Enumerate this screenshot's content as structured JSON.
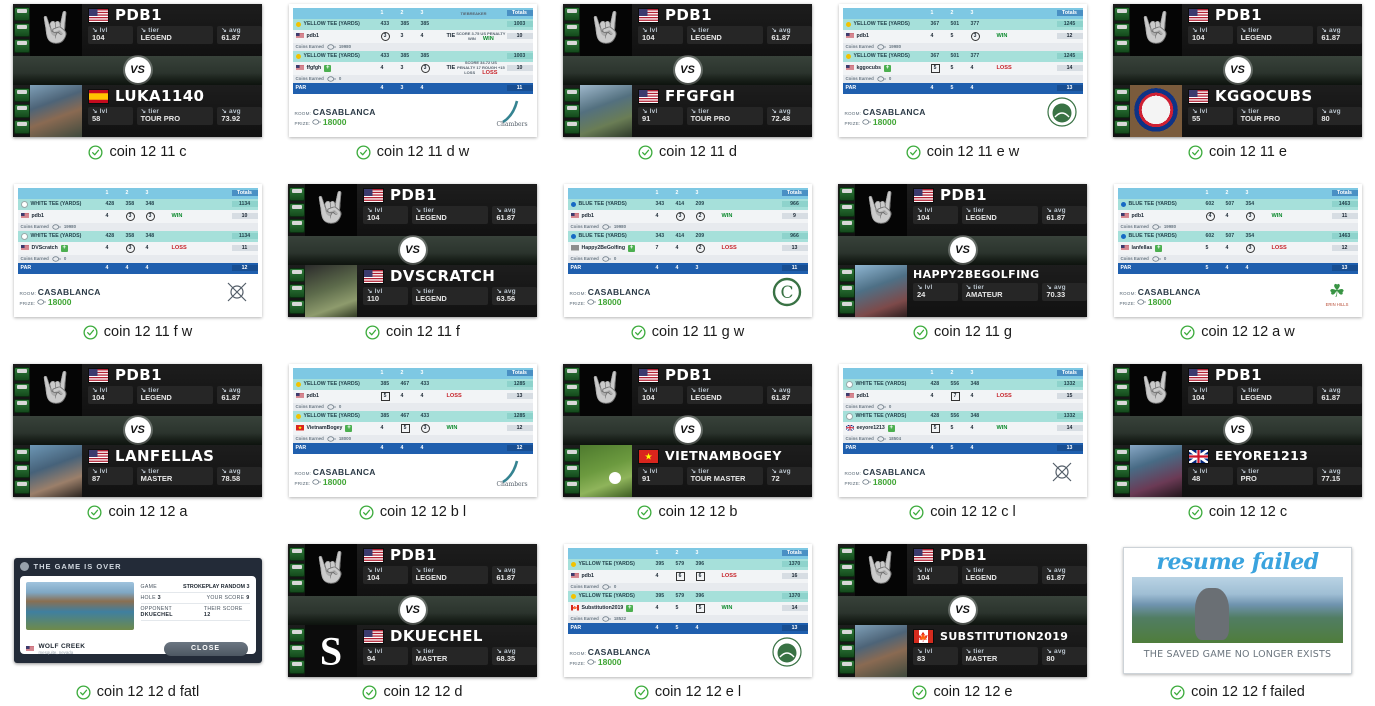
{
  "gallery": {
    "items": [
      {
        "caption": "coin 12 11 c",
        "type": "vs",
        "top": {
          "name": "PDB1",
          "flag": "us",
          "lvl_label": "lvl",
          "lvl": "104",
          "tier_label": "tier",
          "tier": "LEGEND",
          "avg_label": "avg",
          "avg": "61.87",
          "avatar": "skull"
        },
        "bottom": {
          "name": "LUKA1140",
          "flag": "es",
          "lvl_label": "lvl",
          "lvl": "58",
          "tier_label": "tier",
          "tier": "TOUR PRO",
          "avg_label": "avg",
          "avg": "73.92",
          "avatar": "face1"
        },
        "vs": "VS"
      },
      {
        "caption": "coin 12 11 d w",
        "type": "scorecard",
        "tee": "YELLOW TEE (YARDS)",
        "tee_color": "y",
        "yards": [
          "433",
          "385",
          "385"
        ],
        "hdr_holes": [
          "1",
          "2",
          "3"
        ],
        "hdr_tiebreak": "TIEBREAKER",
        "hdr_total": "Totals",
        "yards_total": "1003",
        "p1": {
          "name": "pdb1",
          "flag": "us",
          "scores": [
            "3",
            "3",
            "4"
          ],
          "marks": [
            "circle",
            "",
            ""
          ],
          "result": "TIE",
          "total": "10",
          "coins_label": "Coins Earned",
          "coins": "19980"
        },
        "p2": {
          "name": "ffgfgh",
          "flag": "us",
          "scores": [
            "4",
            "3",
            "3"
          ],
          "marks": [
            "",
            "",
            "circle"
          ],
          "result": "TIE",
          "total": "10",
          "coins_label": "Coins Earned",
          "coins": "0"
        },
        "tb1": "SCORE 3.75  US PENALTY  WIN",
        "tb2": "SCORE 34.72  US PENALTY 17 ROUGH +15  LOSS",
        "tb1_res": "WIN",
        "tb2_res": "LOSS",
        "par_label": "PAR",
        "par": [
          "4",
          "3",
          "4"
        ],
        "par_total": "11",
        "room_label": "ROOM:",
        "room": "CASABLANCA",
        "prize_label": "PRIZE:",
        "prize": "18000",
        "logo": "chambers-bay"
      },
      {
        "caption": "coin 12 11 d",
        "type": "vs",
        "top": {
          "name": "PDB1",
          "flag": "us",
          "lvl_label": "lvl",
          "lvl": "104",
          "tier_label": "tier",
          "tier": "LEGEND",
          "avg_label": "avg",
          "avg": "61.87",
          "avatar": "skull"
        },
        "bottom": {
          "name": "FFGFGH",
          "flag": "us",
          "lvl_label": "lvl",
          "lvl": "91",
          "tier_label": "tier",
          "tier": "TOUR PRO",
          "avg_label": "avg",
          "avg": "72.48",
          "avatar": "face2"
        },
        "vs": "VS"
      },
      {
        "caption": "coin 12 11 e w",
        "type": "scorecard",
        "tee": "YELLOW TEE (YARDS)",
        "tee_color": "y",
        "yards": [
          "367",
          "501",
          "377"
        ],
        "hdr_holes": [
          "1",
          "2",
          "3"
        ],
        "hdr_tiebreak": "",
        "hdr_total": "Totals",
        "yards_total": "1245",
        "p1": {
          "name": "pdb1",
          "flag": "us",
          "scores": [
            "4",
            "5",
            "3"
          ],
          "marks": [
            "",
            "",
            "circle"
          ],
          "result": "WIN",
          "total": "12",
          "coins_label": "Coins Earned",
          "coins": "19980"
        },
        "p2": {
          "name": "kggocubs",
          "flag": "us",
          "scores": [
            "5",
            "5",
            "4"
          ],
          "marks": [
            "square",
            "",
            ""
          ],
          "result": "LOSS",
          "total": "14",
          "coins_label": "Coins Earned",
          "coins": "0"
        },
        "tb1": "",
        "tb2": "",
        "tb1_res": "",
        "tb2_res": "",
        "par_label": "PAR",
        "par": [
          "4",
          "5",
          "4"
        ],
        "par_total": "13",
        "room_label": "ROOM:",
        "room": "CASABLANCA",
        "prize_label": "PRIZE:",
        "prize": "18000",
        "logo": "pebble-beach"
      },
      {
        "caption": "coin 12 11 e",
        "type": "vs",
        "top": {
          "name": "PDB1",
          "flag": "us",
          "lvl_label": "lvl",
          "lvl": "104",
          "tier_label": "tier",
          "tier": "LEGEND",
          "avg_label": "avg",
          "avg": "61.87",
          "avatar": "skull"
        },
        "bottom": {
          "name": "KGGOCUBS",
          "flag": "us",
          "lvl_label": "lvl",
          "lvl": "55",
          "tier_label": "tier",
          "tier": "TOUR PRO",
          "avg_label": "avg",
          "avg": "80",
          "avatar": "cubs"
        },
        "vs": "VS"
      },
      {
        "caption": "coin 12 11 f w",
        "type": "scorecard",
        "tee": "WHITE TEE (YARDS)",
        "tee_color": "w",
        "yards": [
          "428",
          "358",
          "348"
        ],
        "hdr_holes": [
          "1",
          "2",
          "3"
        ],
        "hdr_tiebreak": "",
        "hdr_total": "Totals",
        "yards_total": "1134",
        "p1": {
          "name": "pdb1",
          "flag": "us",
          "scores": [
            "4",
            "3",
            "3"
          ],
          "marks": [
            "",
            "circle",
            "circle"
          ],
          "result": "WIN",
          "total": "10",
          "coins_label": "Coins Earned",
          "coins": "19980"
        },
        "p2": {
          "name": "DVScratch",
          "flag": "us",
          "scores": [
            "4",
            "3",
            "4"
          ],
          "marks": [
            "",
            "circle",
            ""
          ],
          "result": "LOSS",
          "total": "11",
          "coins_label": "Coins Earned",
          "coins": "0"
        },
        "tb1": "",
        "tb2": "",
        "tb1_res": "",
        "tb2_res": "",
        "par_label": "PAR",
        "par": [
          "4",
          "4",
          "4"
        ],
        "par_total": "12",
        "room_label": "ROOM:",
        "room": "CASABLANCA",
        "prize_label": "PRIZE:",
        "prize": "18000",
        "logo": "gleneagles"
      },
      {
        "caption": "coin 12 11 f",
        "type": "vs",
        "top": {
          "name": "PDB1",
          "flag": "us",
          "lvl_label": "lvl",
          "lvl": "104",
          "tier_label": "tier",
          "tier": "LEGEND",
          "avg_label": "avg",
          "avg": "61.87",
          "avatar": "skull"
        },
        "bottom": {
          "name": "DVSCRATCH",
          "flag": "us",
          "lvl_label": "lvl",
          "lvl": "110",
          "tier_label": "tier",
          "tier": "LEGEND",
          "avg_label": "avg",
          "avg": "63.56",
          "avatar": "face3"
        },
        "vs": "VS"
      },
      {
        "caption": "coin 12 11 g w",
        "type": "scorecard",
        "tee": "BLUE TEE (YARDS)",
        "tee_color": "b",
        "yards": [
          "343",
          "414",
          "209"
        ],
        "hdr_holes": [
          "1",
          "2",
          "3"
        ],
        "hdr_tiebreak": "",
        "hdr_total": "Totals",
        "yards_total": "966",
        "p1": {
          "name": "pdb1",
          "flag": "us",
          "scores": [
            "4",
            "3",
            "2"
          ],
          "marks": [
            "",
            "circle",
            "circle"
          ],
          "result": "WIN",
          "total": "9",
          "coins_label": "Coins Earned",
          "coins": "19980"
        },
        "p2": {
          "name": "Happy2BeGolfing",
          "flag": "gray",
          "scores": [
            "7",
            "4",
            "2"
          ],
          "marks": [
            "",
            "",
            "circle"
          ],
          "result": "LOSS",
          "total": "13",
          "coins_label": "Coins Earned",
          "coins": "0"
        },
        "tb1": "",
        "tb2": "",
        "tb1_res": "",
        "tb2_res": "",
        "par_label": "PAR",
        "par": [
          "4",
          "4",
          "3"
        ],
        "par_total": "11",
        "room_label": "ROOM:",
        "room": "CASABLANCA",
        "prize_label": "PRIZE:",
        "prize": "18000",
        "logo": "congressional"
      },
      {
        "caption": "coin 12 11 g",
        "type": "vs",
        "top": {
          "name": "PDB1",
          "flag": "us",
          "lvl_label": "lvl",
          "lvl": "104",
          "tier_label": "tier",
          "tier": "LEGEND",
          "avg_label": "avg",
          "avg": "61.87",
          "avatar": "skull"
        },
        "bottom": {
          "name": "HAPPY2BEGOLFING",
          "flag": "none",
          "lvl_label": "lvl",
          "lvl": "24",
          "tier_label": "tier",
          "tier": "AMATEUR",
          "avg_label": "avg",
          "avg": "70.33",
          "avatar": "face4"
        },
        "vs": "VS"
      },
      {
        "caption": "coin 12 12 a w",
        "type": "scorecard",
        "tee": "BLUE TEE (YARDS)",
        "tee_color": "b",
        "yards": [
          "602",
          "507",
          "354"
        ],
        "hdr_holes": [
          "1",
          "2",
          "3"
        ],
        "hdr_tiebreak": "",
        "hdr_total": "Totals",
        "yards_total": "1463",
        "p1": {
          "name": "pdb1",
          "flag": "us",
          "scores": [
            "4",
            "4",
            "3"
          ],
          "marks": [
            "circle",
            "",
            "circle"
          ],
          "result": "WIN",
          "total": "11",
          "coins_label": "Coins Earned",
          "coins": "19980"
        },
        "p2": {
          "name": "lanfellas",
          "flag": "us",
          "scores": [
            "5",
            "4",
            "3"
          ],
          "marks": [
            "",
            "",
            "circle"
          ],
          "result": "LOSS",
          "total": "12",
          "coins_label": "Coins Earned",
          "coins": "0"
        },
        "tb1": "",
        "tb2": "",
        "tb1_res": "",
        "tb2_res": "",
        "par_label": "PAR",
        "par": [
          "5",
          "4",
          "4"
        ],
        "par_total": "13",
        "room_label": "ROOM:",
        "room": "CASABLANCA",
        "prize_label": "PRIZE:",
        "prize": "18000",
        "logo": "erin-hills"
      },
      {
        "caption": "coin 12 12 a",
        "type": "vs",
        "top": {
          "name": "PDB1",
          "flag": "us",
          "lvl_label": "lvl",
          "lvl": "104",
          "tier_label": "tier",
          "tier": "LEGEND",
          "avg_label": "avg",
          "avg": "61.87",
          "avatar": "skull"
        },
        "bottom": {
          "name": "LANFELLAS",
          "flag": "us",
          "lvl_label": "lvl",
          "lvl": "87",
          "tier_label": "tier",
          "tier": "MASTER",
          "avg_label": "avg",
          "avg": "78.58",
          "avatar": "face5"
        },
        "vs": "VS"
      },
      {
        "caption": "coin 12 12 b l",
        "type": "scorecard",
        "tee": "YELLOW TEE (YARDS)",
        "tee_color": "y",
        "yards": [
          "385",
          "467",
          "433"
        ],
        "hdr_holes": [
          "1",
          "2",
          "3"
        ],
        "hdr_tiebreak": "",
        "hdr_total": "Totals",
        "yards_total": "1285",
        "p1": {
          "name": "pdb1",
          "flag": "us",
          "scores": [
            "5",
            "4",
            "4"
          ],
          "marks": [
            "square",
            "",
            ""
          ],
          "result": "LOSS",
          "total": "13",
          "coins_label": "Coins Earned",
          "coins": "0"
        },
        "p2": {
          "name": "VietnamBogey",
          "flag": "vn",
          "scores": [
            "4",
            "5",
            "3"
          ],
          "marks": [
            "",
            "square",
            "circle"
          ],
          "result": "WIN",
          "total": "12",
          "coins_label": "Coins Earned",
          "coins": "18000"
        },
        "tb1": "",
        "tb2": "",
        "tb1_res": "",
        "tb2_res": "",
        "par_label": "PAR",
        "par": [
          "4",
          "4",
          "4"
        ],
        "par_total": "12",
        "room_label": "ROOM:",
        "room": "CASABLANCA",
        "prize_label": "PRIZE:",
        "prize": "18000",
        "logo": "chambers-bay"
      },
      {
        "caption": "coin 12 12 b",
        "type": "vs",
        "top": {
          "name": "PDB1",
          "flag": "us",
          "lvl_label": "lvl",
          "lvl": "104",
          "tier_label": "tier",
          "tier": "LEGEND",
          "avg_label": "avg",
          "avg": "61.87",
          "avatar": "skull"
        },
        "bottom": {
          "name": "VIETNAMBOGEY",
          "flag": "vn",
          "lvl_label": "lvl",
          "lvl": "91",
          "tier_label": "tier",
          "tier": "TOUR MASTER",
          "avg_label": "avg",
          "avg": "72",
          "avatar": "grass"
        },
        "vs": "VS"
      },
      {
        "caption": "coin 12 12 c l",
        "type": "scorecard",
        "tee": "WHITE TEE (YARDS)",
        "tee_color": "w",
        "yards": [
          "428",
          "556",
          "348"
        ],
        "hdr_holes": [
          "1",
          "2",
          "3"
        ],
        "hdr_tiebreak": "",
        "hdr_total": "Totals",
        "yards_total": "1332",
        "p1": {
          "name": "pdb1",
          "flag": "us",
          "scores": [
            "4",
            "7",
            "4"
          ],
          "marks": [
            "",
            "square",
            ""
          ],
          "result": "LOSS",
          "total": "15",
          "coins_label": "Coins Earned",
          "coins": "0"
        },
        "p2": {
          "name": "eeyore1213",
          "flag": "gb",
          "scores": [
            "5",
            "5",
            "4"
          ],
          "marks": [
            "square",
            "",
            ""
          ],
          "result": "WIN",
          "total": "14",
          "coins_label": "Coins Earned",
          "coins": "18504"
        },
        "tb1": "",
        "tb2": "",
        "tb1_res": "",
        "tb2_res": "",
        "par_label": "PAR",
        "par": [
          "4",
          "5",
          "4"
        ],
        "par_total": "13",
        "room_label": "ROOM:",
        "room": "CASABLANCA",
        "prize_label": "PRIZE:",
        "prize": "18000",
        "logo": "gleneagles"
      },
      {
        "caption": "coin 12 12 c",
        "type": "vs",
        "top": {
          "name": "PDB1",
          "flag": "us",
          "lvl_label": "lvl",
          "lvl": "104",
          "tier_label": "tier",
          "tier": "LEGEND",
          "avg_label": "avg",
          "avg": "61.87",
          "avatar": "skull"
        },
        "bottom": {
          "name": "EEYORE1213",
          "flag": "gb",
          "lvl_label": "lvl",
          "lvl": "48",
          "tier_label": "tier",
          "tier": "PRO",
          "avg_label": "avg",
          "avg": "77.15",
          "avatar": "face6"
        },
        "vs": "VS"
      },
      {
        "caption": "coin 12 12 d fatl",
        "type": "gameover",
        "title": "THE GAME IS OVER",
        "game_label": "GAME",
        "game_value": "STROKEPLAY RANDOM 3",
        "hole_label": "HOLE",
        "hole_value": "3",
        "your_score_label": "YOUR SCORE",
        "your_score": "9",
        "opponent_label": "OPPONENT",
        "opponent_value": "DKUECHEL",
        "their_score_label": "THEIR SCORE",
        "their_score": "12",
        "course": "WOLF CREEK",
        "course_sub": "mesquite, nevada",
        "close": "CLOSE"
      },
      {
        "caption": "coin 12 12 d",
        "type": "vs",
        "top": {
          "name": "PDB1",
          "flag": "us",
          "lvl_label": "lvl",
          "lvl": "104",
          "tier_label": "tier",
          "tier": "LEGEND",
          "avg_label": "avg",
          "avg": "61.87",
          "avatar": "skull"
        },
        "bottom": {
          "name": "DKUECHEL",
          "flag": "us",
          "lvl_label": "lvl",
          "lvl": "94",
          "tier_label": "tier",
          "tier": "MASTER",
          "avg_label": "avg",
          "avg": "68.35",
          "avatar": "sox"
        },
        "vs": "VS"
      },
      {
        "caption": "coin 12 12 e l",
        "type": "scorecard",
        "tee": "YELLOW TEE (YARDS)",
        "tee_color": "y",
        "yards": [
          "395",
          "579",
          "396"
        ],
        "hdr_holes": [
          "1",
          "2",
          "3"
        ],
        "hdr_tiebreak": "",
        "hdr_total": "Totals",
        "yards_total": "1370",
        "p1": {
          "name": "pdb1",
          "flag": "us",
          "scores": [
            "4",
            "6",
            "6"
          ],
          "marks": [
            "",
            "square",
            "square"
          ],
          "result": "LOSS",
          "total": "16",
          "coins_label": "Coins Earned",
          "coins": "0"
        },
        "p2": {
          "name": "Substitution2019",
          "flag": "ca",
          "scores": [
            "4",
            "5",
            "5"
          ],
          "marks": [
            "",
            "",
            "square"
          ],
          "result": "WIN",
          "total": "14",
          "coins_label": "Coins Earned",
          "coins": "18522"
        },
        "tb1": "",
        "tb2": "",
        "tb1_res": "",
        "tb2_res": "",
        "par_label": "PAR",
        "par": [
          "4",
          "5",
          "4"
        ],
        "par_total": "13",
        "room_label": "ROOM:",
        "room": "CASABLANCA",
        "prize_label": "PRIZE:",
        "prize": "18000",
        "logo": "pebble-beach"
      },
      {
        "caption": "coin 12 12 e",
        "type": "vs",
        "top": {
          "name": "PDB1",
          "flag": "us",
          "lvl_label": "lvl",
          "lvl": "104",
          "tier_label": "tier",
          "tier": "LEGEND",
          "avg_label": "avg",
          "avg": "61.87",
          "avatar": "skull"
        },
        "bottom": {
          "name": "SUBSTITUTION2019",
          "flag": "ca",
          "lvl_label": "lvl",
          "lvl": "83",
          "tier_label": "tier",
          "tier": "MASTER",
          "avg_label": "avg",
          "avg": "80",
          "avatar": "face1"
        },
        "vs": "VS"
      },
      {
        "caption": "coin 12 12 f failed",
        "type": "resumefailed",
        "title": "resume failed",
        "subtitle": "THE SAVED GAME NO LONGER EXISTS"
      }
    ]
  },
  "colors": {
    "check_green": "#3bab3b",
    "caption_text": "#1a1a1a",
    "win_green": "#0d8a2e",
    "loss_red": "#c7232a",
    "par_blue": "#1f5fae",
    "tee_teal": "#a6e0da",
    "header_blue": "#7ec8e3",
    "prize_green": "#3fa534",
    "resume_blue": "#3aa3de"
  }
}
